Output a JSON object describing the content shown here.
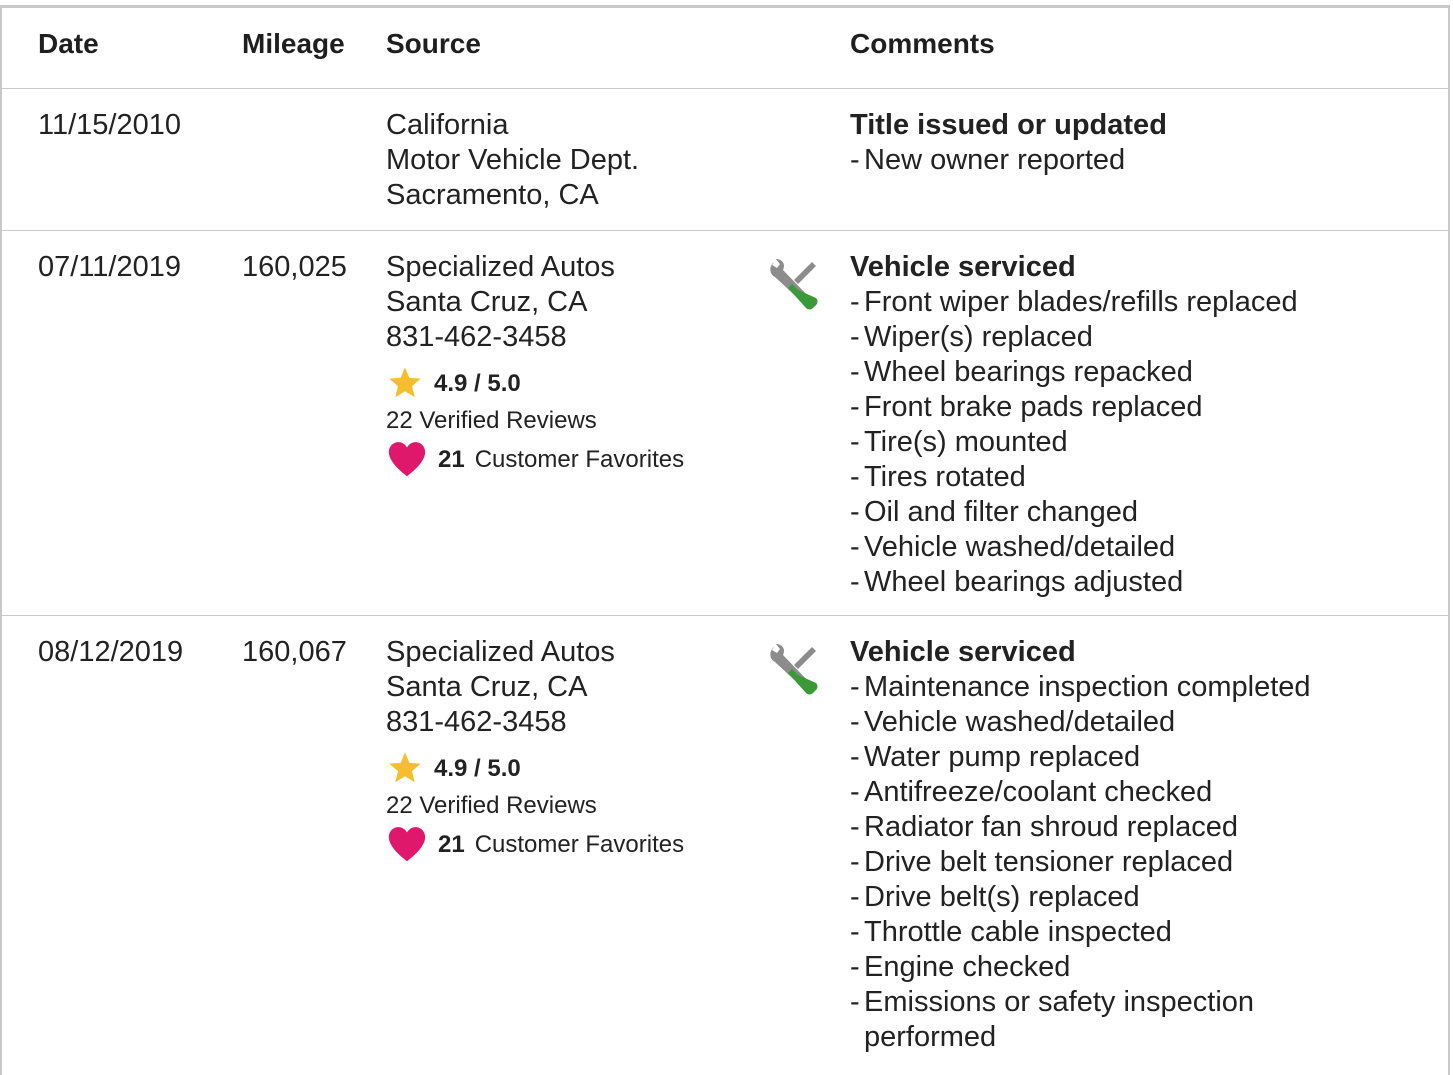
{
  "table": {
    "headers": {
      "date": "Date",
      "mileage": "Mileage",
      "source": "Source",
      "comments": "Comments"
    },
    "rows": [
      {
        "date": "11/15/2010",
        "mileage": "",
        "source": [
          "California",
          "Motor Vehicle Dept.",
          "Sacramento, CA"
        ],
        "comment_title": "Title issued or updated",
        "comments": [
          "New owner reported"
        ]
      },
      {
        "date": "07/11/2019",
        "mileage": "160,025",
        "source": [
          "Specialized Autos",
          "Santa Cruz, CA",
          "831-462-3458"
        ],
        "rating": "4.9 / 5.0",
        "reviews": "22 Verified Reviews",
        "favorites_count": "21",
        "favorites_label": "Customer Favorites",
        "comment_title": "Vehicle serviced",
        "comments": [
          "Front wiper blades/refills replaced",
          "Wiper(s) replaced",
          "Wheel bearings repacked",
          "Front brake pads replaced",
          "Tire(s) mounted",
          "Tires rotated",
          "Oil and filter changed",
          "Vehicle washed/detailed",
          "Wheel bearings adjusted"
        ]
      },
      {
        "date": "08/12/2019",
        "mileage": "160,067",
        "source": [
          "Specialized Autos",
          "Santa Cruz, CA",
          "831-462-3458"
        ],
        "rating": "4.9 / 5.0",
        "reviews": "22 Verified Reviews",
        "favorites_count": "21",
        "favorites_label": "Customer Favorites",
        "comment_title": "Vehicle serviced",
        "comments": [
          "Maintenance inspection completed",
          "Vehicle washed/detailed",
          "Water pump replaced",
          "Antifreeze/coolant checked",
          "Radiator fan shroud replaced",
          "Drive belt tensioner replaced",
          "Drive belt(s) replaced",
          "Throttle cable inspected",
          "Engine checked",
          "Emissions or safety inspection performed"
        ]
      }
    ]
  },
  "icons": {
    "service": "wrench-screwdriver-icon",
    "rating": "star-icon",
    "favorite": "heart-icon"
  },
  "colors": {
    "star": "#f6be2c",
    "heart": "#e0186c",
    "tool_gray": "#8c8c8c",
    "tool_green": "#3a9a3a",
    "border": "#c8c8c8"
  }
}
